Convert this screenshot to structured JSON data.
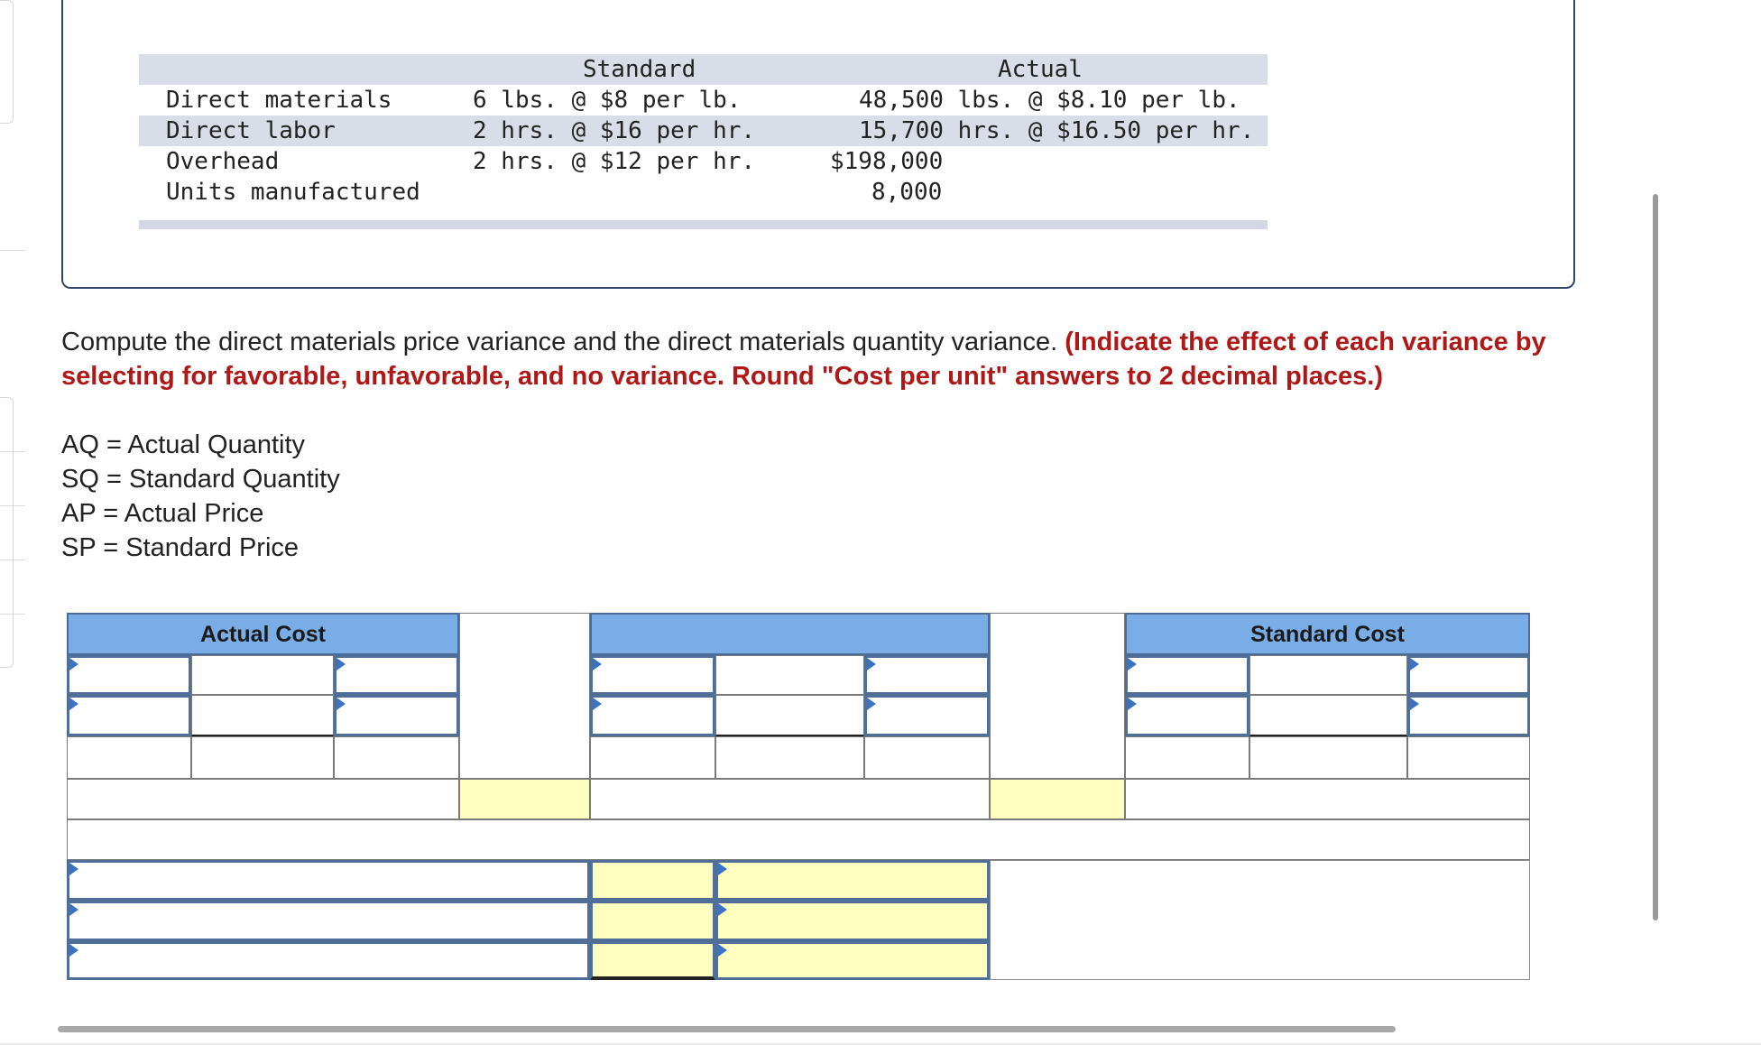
{
  "data_table": {
    "headers": [
      "Standard",
      "Actual"
    ],
    "rows": [
      {
        "label": "Direct materials",
        "standard": "6 lbs. @ $8 per lb.",
        "actual": "48,500 lbs. @ $8.10 per lb."
      },
      {
        "label": "Direct labor",
        "standard": "2 hrs. @ $16 per hr.",
        "actual": "15,700 hrs. @ $16.50 per hr."
      },
      {
        "label": "Overhead",
        "standard": "2 hrs. @ $12 per hr.",
        "actual": "$198,000"
      },
      {
        "label": "Units manufactured",
        "standard": "",
        "actual": "8,000"
      }
    ]
  },
  "instructions": {
    "plain": "Compute the direct materials price variance and the direct materials quantity variance. ",
    "emphasis": "(Indicate the effect of each variance by selecting for favorable, unfavorable, and no variance. Round \"Cost per unit\" answers to 2 decimal places.)"
  },
  "definitions": [
    "AQ = Actual Quantity",
    "SQ = Standard Quantity",
    "AP = Actual Price",
    "SP = Standard Price"
  ],
  "grid": {
    "actual_cost_header": "Actual Cost",
    "middle_header": "",
    "standard_cost_header": "Standard Cost"
  },
  "colors": {
    "header_blue": "#7aace6",
    "answer_yellow": "#ffffbf",
    "emphasis_red": "#b01818",
    "dropdown_marker": "#3b72c4"
  }
}
